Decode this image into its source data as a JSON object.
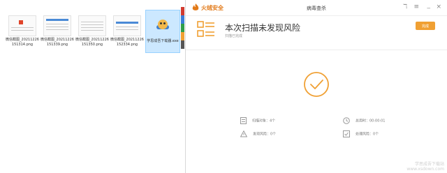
{
  "explorer": {
    "files": [
      {
        "name": "微信截图_20211226151314.png"
      },
      {
        "name": "微信截图_20211226151339.png"
      },
      {
        "name": "微信截图_20211226151350.png"
      },
      {
        "name": "微信截图_20211226152334.png"
      },
      {
        "name": "学思成吾下载器.exe",
        "selected": true
      }
    ]
  },
  "window": {
    "brand": "火绒安全",
    "title": "病毒查杀",
    "controls": {
      "menu": "≡",
      "minimize": "_",
      "close": "×",
      "skin": "ℸ"
    }
  },
  "scan": {
    "result_title": "本次扫描未发现风险",
    "status": "扫描已完成",
    "complete_button": "完成"
  },
  "stats": {
    "objects": "扫描对象：4个",
    "duration": "总用时：00:00:01",
    "risks_found": "发现风险：0个",
    "risks_handled": "处理风险：0个"
  },
  "watermark": {
    "line1": "学思成吾下载站",
    "line2": "www.xsdown.com"
  },
  "colors": {
    "accent": "#f0a033",
    "brand": "#e27a19",
    "icon": "#f0a033"
  }
}
